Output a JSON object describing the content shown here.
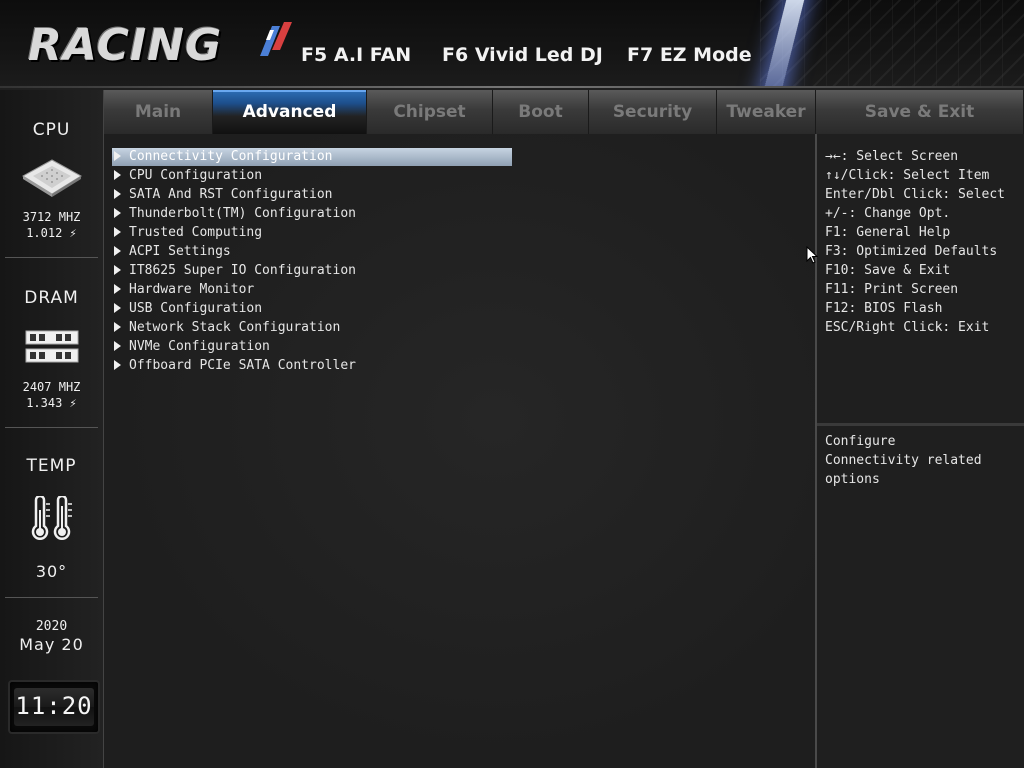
{
  "header": {
    "logo_text": "RACING",
    "hotkeys": [
      {
        "label": "F5 A.I FAN"
      },
      {
        "label": "F6 Vivid Led DJ"
      },
      {
        "label": "F7 EZ Mode"
      }
    ]
  },
  "sidebar": {
    "cpu": {
      "title": "CPU",
      "freq": "3712 MHZ",
      "volt": "1.012 ⚡"
    },
    "dram": {
      "title": "DRAM",
      "freq": "2407 MHZ",
      "volt": "1.343 ⚡"
    },
    "temp": {
      "title": "TEMP",
      "value": "30°"
    },
    "date": {
      "year": "2020",
      "month_day": "May 20"
    },
    "clock": "11:20"
  },
  "tabs": [
    {
      "label": "Main"
    },
    {
      "label": "Advanced",
      "active": true
    },
    {
      "label": "Chipset"
    },
    {
      "label": "Boot"
    },
    {
      "label": "Security"
    },
    {
      "label": "Tweaker"
    },
    {
      "label": "Save & Exit"
    }
  ],
  "menu": [
    {
      "label": "Connectivity Configuration",
      "selected": true
    },
    {
      "label": "CPU Configuration"
    },
    {
      "label": "SATA And RST Configuration"
    },
    {
      "label": "Thunderbolt(TM) Configuration"
    },
    {
      "label": "Trusted Computing"
    },
    {
      "label": "ACPI Settings"
    },
    {
      "label": "IT8625 Super IO Configuration"
    },
    {
      "label": "Hardware Monitor"
    },
    {
      "label": "USB Configuration"
    },
    {
      "label": "Network Stack Configuration"
    },
    {
      "label": "NVMe Configuration"
    },
    {
      "label": "Offboard PCIe SATA Controller"
    }
  ],
  "help": {
    "keys": [
      "→←: Select Screen",
      "↑↓/Click: Select Item",
      "Enter/Dbl Click: Select",
      "+/-: Change Opt.",
      "F1: General Help",
      "F3: Optimized Defaults",
      "F10: Save & Exit",
      "F11: Print Screen",
      "F12: BIOS Flash",
      "ESC/Right Click: Exit"
    ],
    "description": [
      "Configure",
      "Connectivity related",
      "options"
    ]
  },
  "colors": {
    "accent": "#1d4f8c",
    "selection": "#a9b8c8",
    "background": "#1f1f1f"
  }
}
